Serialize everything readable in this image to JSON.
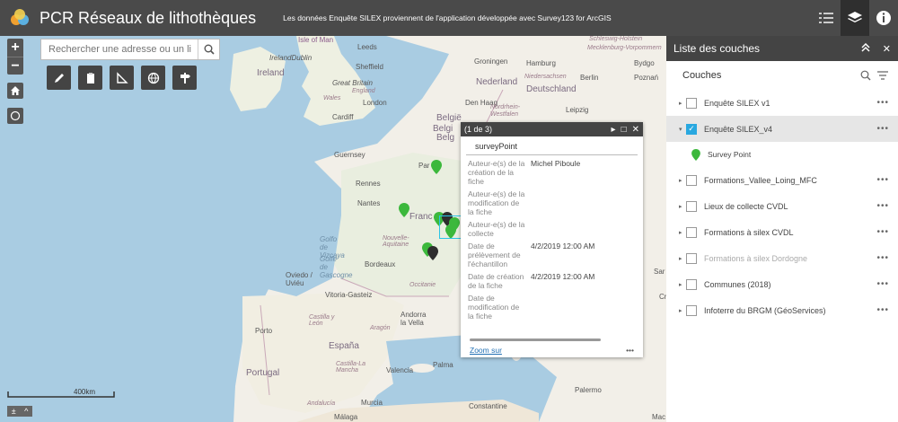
{
  "header": {
    "title": "PCR Réseaux de lithothèques",
    "subtitle": "Les données Enquête SILEX proviennent de l'application développée avec Survey123 for ArcGIS"
  },
  "search": {
    "placeholder": "Rechercher une adresse ou un li"
  },
  "map": {
    "labels": {
      "isle_of_man": "Isle of Man",
      "leeds": "Leeds",
      "ireland_dublin": "IrelandDublin",
      "sheffield": "Sheffield",
      "ireland": "Ireland",
      "great_britain": "Great Britain",
      "england": "England",
      "wales": "Wales",
      "london": "London",
      "cardiff": "Cardiff",
      "groningen": "Groningen",
      "hamburg": "Hamburg",
      "bydgo": "Bydgo",
      "nederland": "Nederland",
      "niedersachsen": "Niedersachsen",
      "berlin": "Berlin",
      "poznan": "Poznań",
      "deutschland": "Deutschland",
      "den_haag": "Den Haag",
      "nordrhein": "Nordrhein-",
      "westfalen": "Westfalen",
      "leipzig": "Leipzig",
      "belgie": "België",
      "belg": "Belgi",
      "belg2": "Belg",
      "guernsey": "Guernsey",
      "paris": "Par",
      "rennes": "Rennes",
      "nantes": "Nantes",
      "france": "Franc",
      "golfo_vizcaya": "Golfo de Vizcaya",
      "golfe_gascogne": "Golfe de Gascogne",
      "nouvelle_aquitaine": "Nouvelle-Aquitaine",
      "bordeaux": "Bordeaux",
      "oviedo": "Oviedo / Uviéu",
      "occitanie": "Occitanie",
      "vitoria": "Vitoria-Gasteiz",
      "andorra": "Andorra la Vella",
      "castilla_leon": "Castilla y León",
      "aragon": "Aragón",
      "porto": "Porto",
      "espana": "España",
      "castilla_mancha": "Castilla-La Mancha",
      "valencia": "Valencia",
      "palma": "Palma",
      "portugal": "Portugal",
      "andalucia": "Andalucía",
      "murcia": "Murcia",
      "palermo": "Palermo",
      "constantine": "Constantine",
      "malaga": "Málaga",
      "cr": "Cr",
      "sar": "Sar",
      "mecklenburg": "Mecklenburg-Vorpommern",
      "schleswig": "Schleswig-Holstein",
      "mac": "Mac"
    },
    "scale_label": "400km"
  },
  "popup": {
    "pager": "(1 de 3)",
    "title": "surveyPoint",
    "attributes": [
      {
        "key": "Auteur-e(s) de la création de la fiche",
        "value": "Michel Piboule"
      },
      {
        "key": "Auteur-e(s) de la modification de la fiche",
        "value": ""
      },
      {
        "key": "Auteur-e(s) de la collecte",
        "value": ""
      },
      {
        "key": "Date de prélèvement de l'échantillon",
        "value": "4/2/2019 12:00 AM"
      },
      {
        "key": "Date de création de la fiche",
        "value": "4/2/2019 12:00 AM"
      },
      {
        "key": "Date de modification de la fiche",
        "value": ""
      }
    ],
    "zoom_link": "Zoom sur",
    "more": "•••"
  },
  "panel": {
    "title": "Liste des couches",
    "section": "Couches",
    "layers": [
      {
        "name": "Enquête SILEX v1",
        "checked": false,
        "dim": false
      },
      {
        "name": "Enquête SILEX_v4",
        "checked": true,
        "dim": false
      },
      {
        "name": "Formations_Vallee_Loing_MFC",
        "checked": false,
        "dim": false
      },
      {
        "name": "Lieux de collecte CVDL",
        "checked": false,
        "dim": false
      },
      {
        "name": "Formations à silex CVDL",
        "checked": false,
        "dim": false
      },
      {
        "name": "Formations à silex Dordogne",
        "checked": false,
        "dim": true
      },
      {
        "name": "Communes (2018)",
        "checked": false,
        "dim": false
      },
      {
        "name": "Infoterre du BRGM (GéoServices)",
        "checked": false,
        "dim": false
      }
    ],
    "legend_label": "Survey Point",
    "dots": "•••"
  },
  "colors": {
    "header": "#4a4a4a",
    "accent": "#29a8e0",
    "pin": "#3cb83c",
    "water": "#a9cce2",
    "land": "#f2efe8"
  }
}
